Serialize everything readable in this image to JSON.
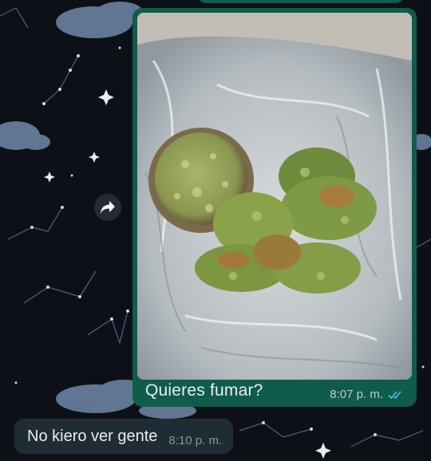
{
  "chat": {
    "outgoing": {
      "caption": "Quieres fumar?",
      "time": "8:07 p. m.",
      "status_icon": "double-check-read-icon",
      "image_subject": "plastic-bag-photo"
    },
    "incoming": {
      "text": "No kiero ver gente",
      "time": "8:10 p. m."
    },
    "forward_icon": "forward-arrow-icon"
  },
  "colors": {
    "outgoing_bubble": "#0f5c4a",
    "incoming_bubble": "#1f2c34",
    "read_ticks": "#53bdeb",
    "wallpaper": "#0d1117"
  }
}
